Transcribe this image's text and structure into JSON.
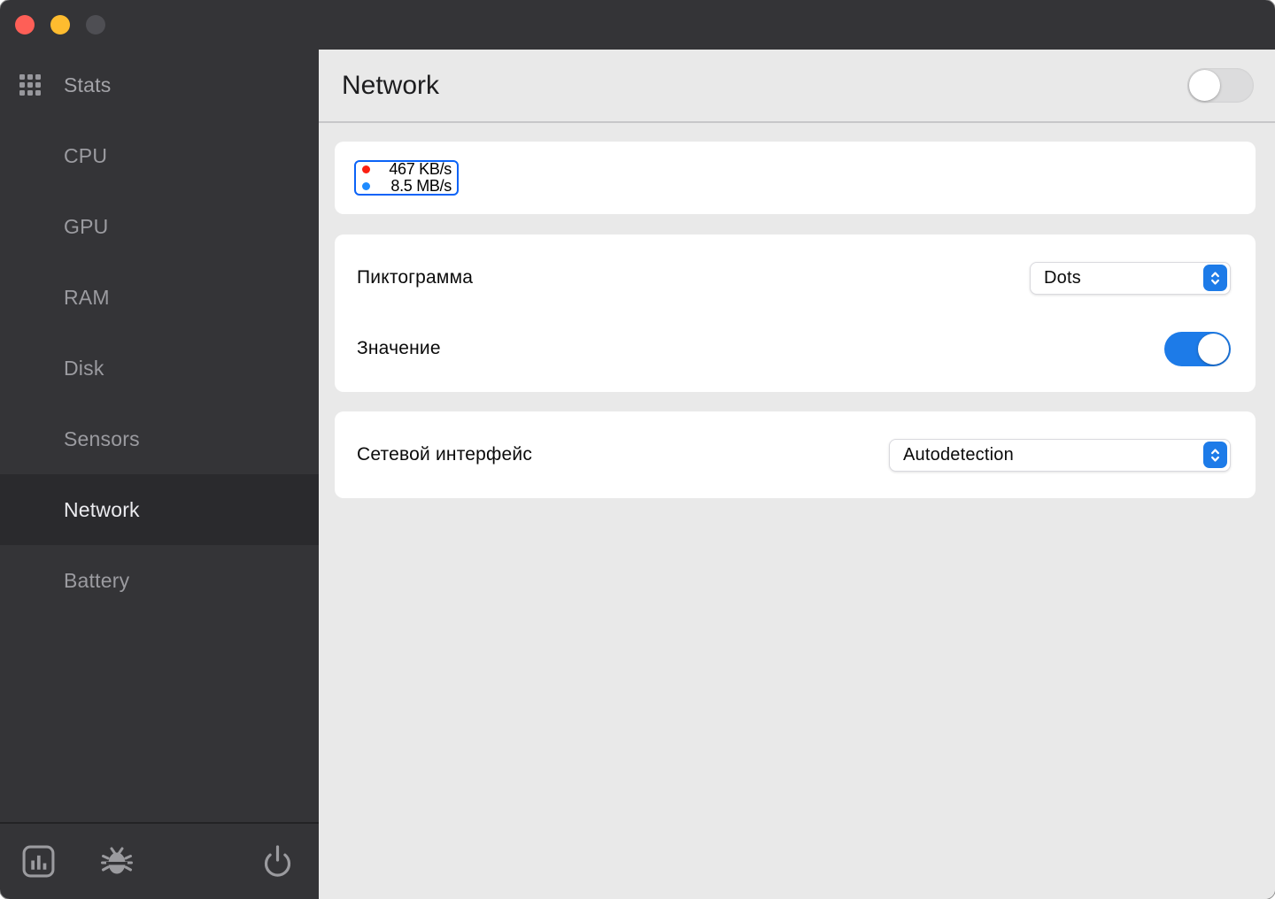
{
  "window": {
    "traffic_lights": {
      "close": "#fe5f57",
      "minimize": "#febc2f",
      "zoom": "#4e4e53"
    }
  },
  "sidebar": {
    "app_label": "Stats",
    "items": [
      {
        "label": "CPU"
      },
      {
        "label": "GPU"
      },
      {
        "label": "RAM"
      },
      {
        "label": "Disk"
      },
      {
        "label": "Sensors"
      },
      {
        "label": "Network",
        "selected": true
      },
      {
        "label": "Battery"
      }
    ],
    "footer_icons": [
      {
        "name": "bar-chart"
      },
      {
        "name": "bug"
      },
      {
        "name": "power"
      }
    ]
  },
  "header": {
    "title": "Network",
    "module_toggle_state": "off"
  },
  "main": {
    "accent_color": "#1d7be8",
    "preview_card": {
      "widget": {
        "border_color": "#0b63f7",
        "rows": [
          {
            "dot_color": "#fb1f12",
            "value": "467 KB/s"
          },
          {
            "dot_color": "#1f8bff",
            "value": "8.5 MB/s"
          }
        ]
      }
    },
    "widget_settings_card": {
      "rows": [
        {
          "label": "Пиктограмма",
          "control": {
            "type": "dropdown",
            "value": "Dots"
          }
        },
        {
          "label": "Значение",
          "control": {
            "type": "toggle",
            "state": "on"
          }
        }
      ]
    },
    "module_settings_card": {
      "rows": [
        {
          "label": "Сетевой интерфейс",
          "control": {
            "type": "dropdown",
            "value": "Autodetection"
          }
        }
      ]
    }
  }
}
